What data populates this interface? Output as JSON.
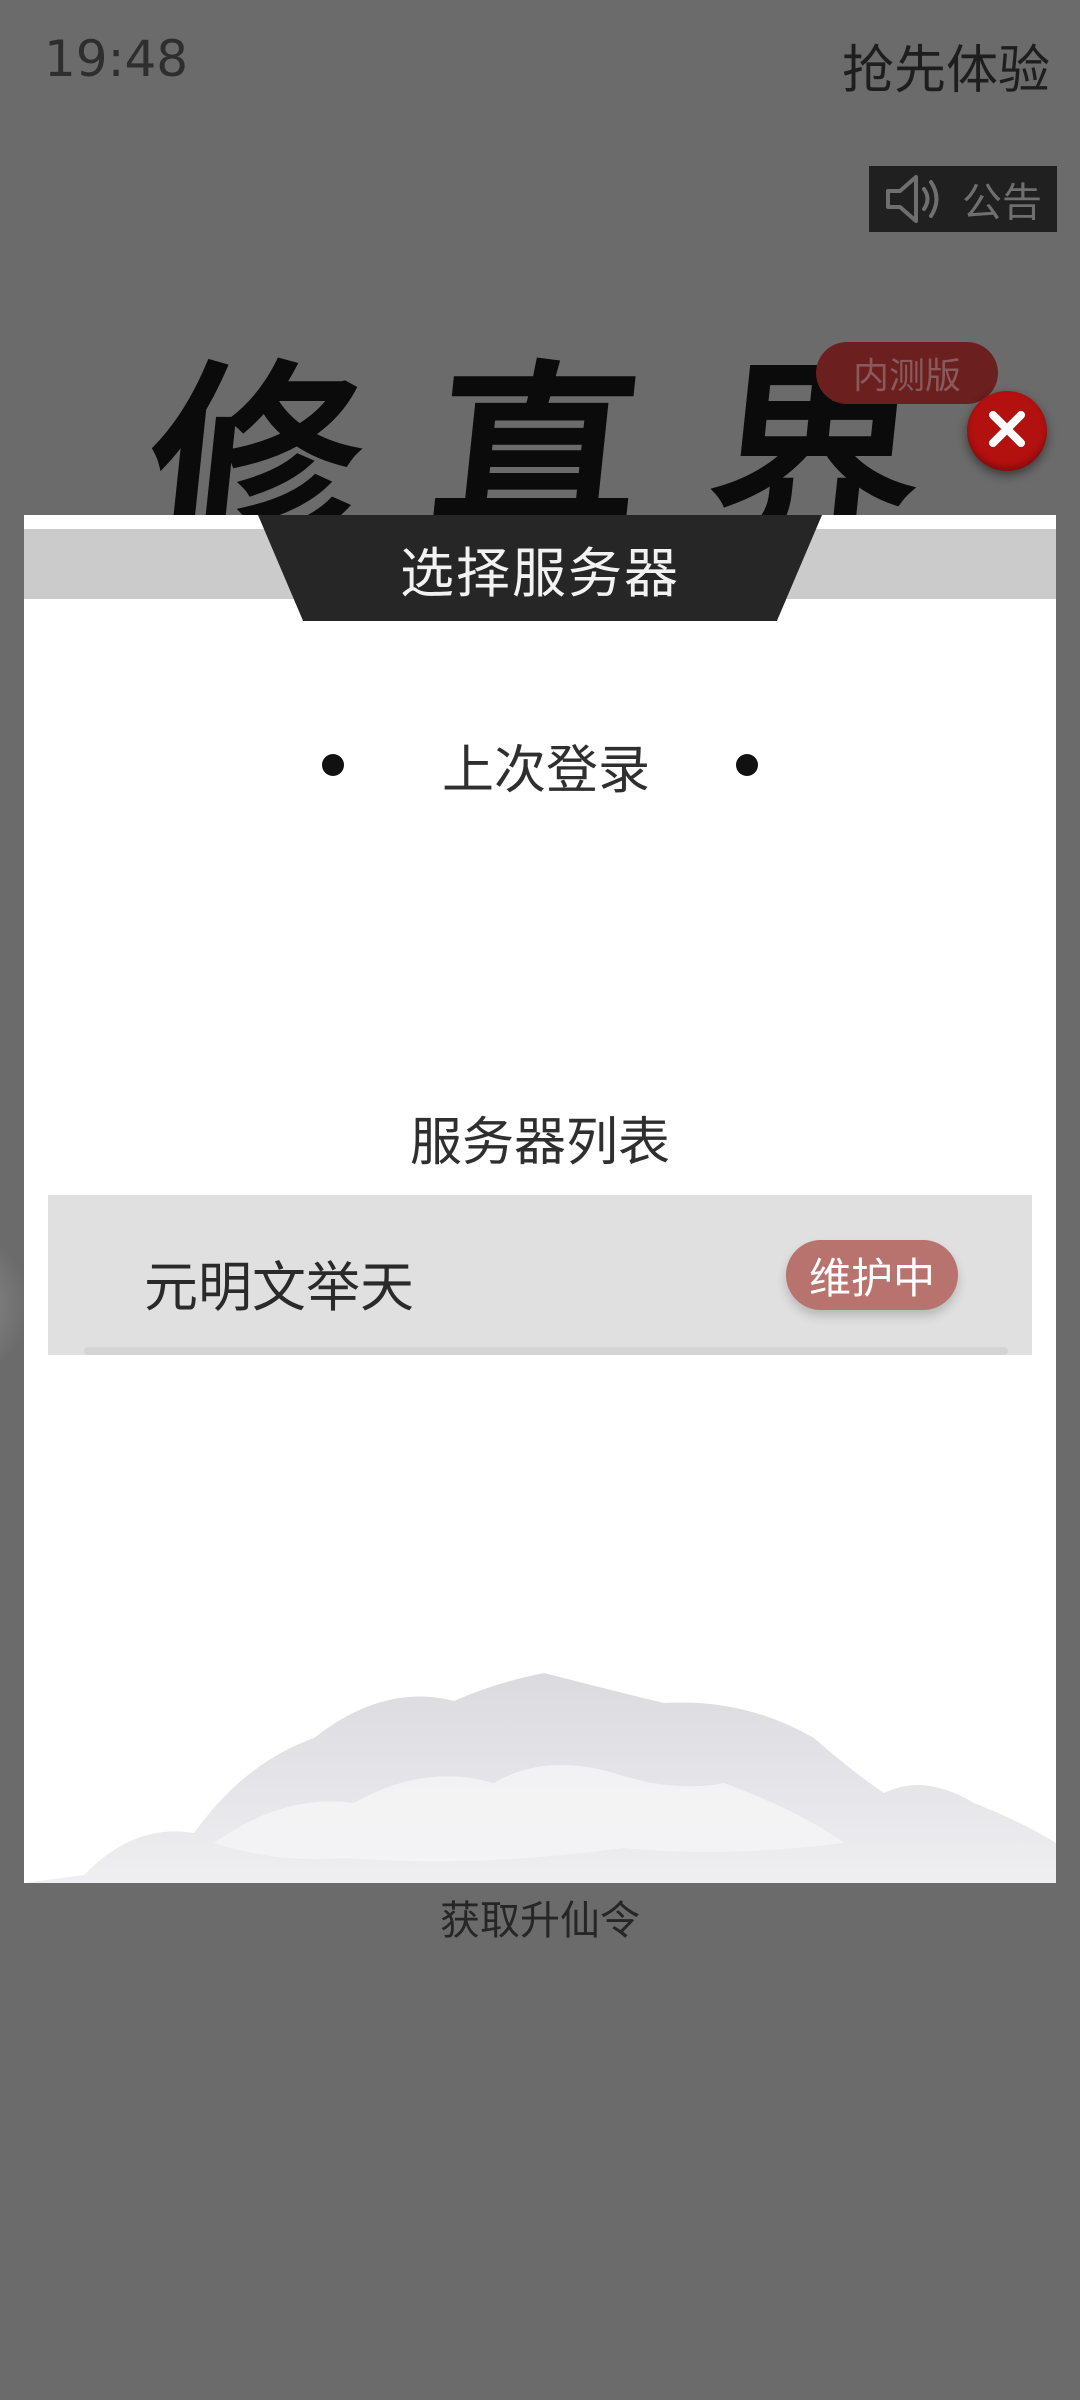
{
  "status_bar": {
    "time": "19:48"
  },
  "header": {
    "early_access_label": "抢先体验",
    "notice_label": "公告",
    "notice_icon": "speaker-icon"
  },
  "game": {
    "logo_text": "修真界",
    "beta_badge": "内测版"
  },
  "dialog": {
    "title": "选择服务器",
    "close_icon": "close-icon",
    "last_login_label": "上次登录",
    "server_list_title": "服务器列表",
    "servers": [
      {
        "name": "元明文举天",
        "status": "维护中",
        "status_color": "#b9736f"
      }
    ]
  },
  "footer": {
    "get_token_link": "获取升仙令"
  },
  "colors": {
    "background": "#6b6b6b",
    "dialog_title_bg": "#262626",
    "close_button": "#b31010"
  }
}
